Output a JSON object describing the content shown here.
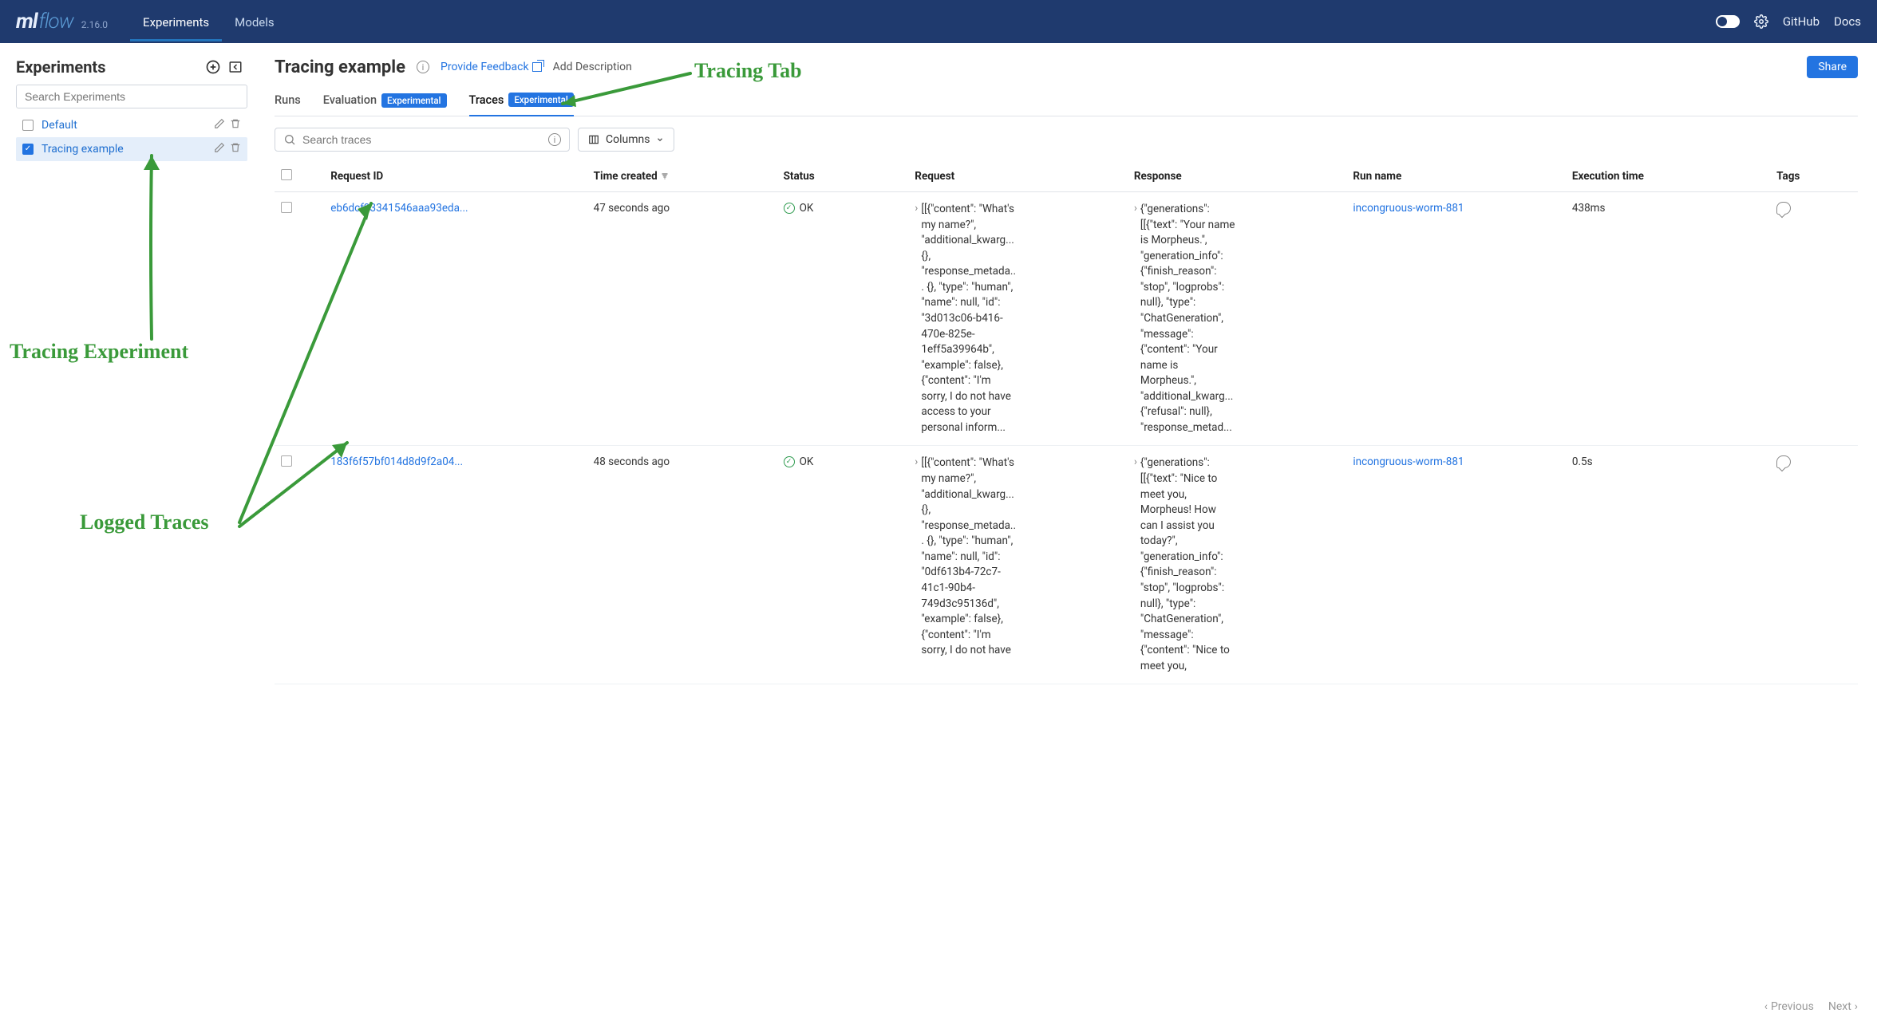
{
  "header": {
    "logo_ml": "ml",
    "logo_flow": "flow",
    "version": "2.16.0",
    "nav": [
      "Experiments",
      "Models"
    ],
    "active_nav": 0,
    "right": {
      "github": "GitHub",
      "docs": "Docs"
    }
  },
  "sidebar": {
    "title": "Experiments",
    "search_placeholder": "Search Experiments",
    "items": [
      {
        "label": "Default",
        "selected": false
      },
      {
        "label": "Tracing example",
        "selected": true
      }
    ]
  },
  "main": {
    "title": "Tracing example",
    "feedback": "Provide Feedback",
    "add_description": "Add Description",
    "share": "Share",
    "tabs": [
      {
        "label": "Runs",
        "badge": null
      },
      {
        "label": "Evaluation",
        "badge": "Experimental"
      },
      {
        "label": "Traces",
        "badge": "Experimental"
      }
    ],
    "active_tab": 2,
    "search_traces_placeholder": "Search traces",
    "columns_btn": "Columns"
  },
  "table": {
    "headers": {
      "request_id": "Request ID",
      "time_created": "Time created",
      "status": "Status",
      "request": "Request",
      "response": "Response",
      "run_name": "Run name",
      "execution_time": "Execution time",
      "tags": "Tags"
    },
    "rows": [
      {
        "request_id": "eb6dcf93341546aaa93eda...",
        "time_created": "47 seconds ago",
        "status": "OK",
        "request": "[[{\"content\": \"What's my name?\", \"additional_kwarg... {}, \"response_metada... {}, \"type\": \"human\", \"name\": null, \"id\": \"3d013c06-b416-470e-825e-1eff5a39964b\", \"example\": false}, {\"content\": \"I'm sorry, I do not have access to your personal inform...",
        "response": "{\"generations\": [[{\"text\": \"Your name is Morpheus.\", \"generation_info\": {\"finish_reason\": \"stop\", \"logprobs\": null}, \"type\": \"ChatGeneration\", \"message\": {\"content\": \"Your name is Morpheus.\", \"additional_kwarg... {\"refusal\": null}, \"response_metad...",
        "run_name": "incongruous-worm-881",
        "execution_time": "438ms"
      },
      {
        "request_id": "183f6f57bf014d8d9f2a04...",
        "time_created": "48 seconds ago",
        "status": "OK",
        "request": "[[{\"content\": \"What's my name?\", \"additional_kwarg... {}, \"response_metada... {}, \"type\": \"human\", \"name\": null, \"id\": \"0df613b4-72c7-41c1-90b4-749d3c95136d\", \"example\": false}, {\"content\": \"I'm sorry, I do not have",
        "response": "{\"generations\": [[{\"text\": \"Nice to meet you, Morpheus! How can I assist you today?\", \"generation_info\": {\"finish_reason\": \"stop\", \"logprobs\": null}, \"type\": \"ChatGeneration\", \"message\": {\"content\": \"Nice to meet you,",
        "run_name": "incongruous-worm-881",
        "execution_time": "0.5s"
      }
    ]
  },
  "pager": {
    "prev": "Previous",
    "next": "Next"
  },
  "annotations": {
    "tracing_tab": "Tracing Tab",
    "tracing_experiment": "Tracing Experiment",
    "logged_traces": "Logged Traces"
  }
}
